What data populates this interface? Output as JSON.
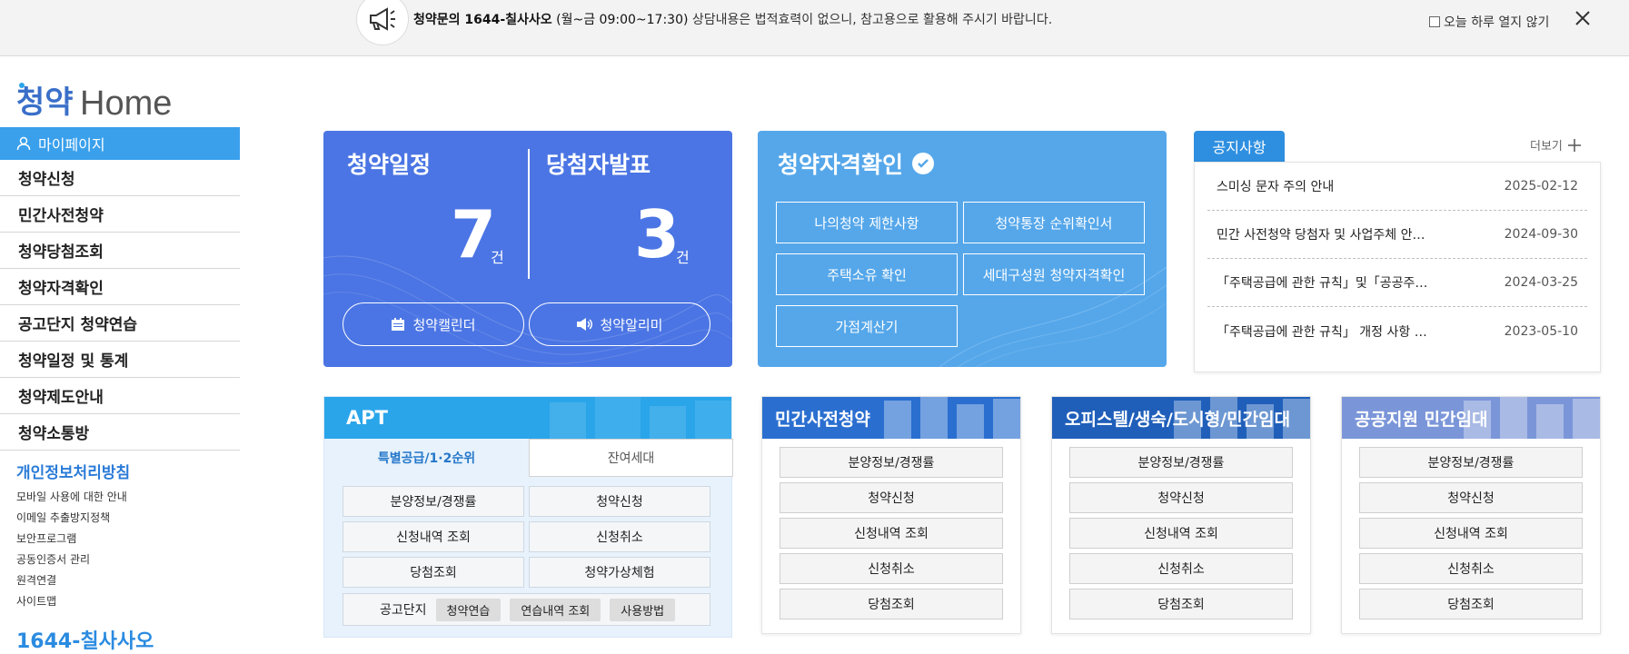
{
  "topbar": {
    "notice_bold": "청약문의 1644-칠사사오",
    "notice_hours": "(월~금 09:00~17:30)",
    "notice_rest": "상담내용은 법적효력이 없으니, 참고용으로 활용해 주시기 바랍니다.",
    "today_close_label": "오늘 하루 열지 않기"
  },
  "colors": {
    "sidebar_active": "#3aa0ec",
    "schedule_card": "#4b75e4",
    "qual_card": "#55a7ea",
    "notice_tab": "#2e8fe0",
    "apt_head": "#2aa5ea",
    "private_head": "#2a6fd0",
    "officetel_head": "#1f5fba",
    "public_head": "#7b96d8"
  },
  "sidebar": {
    "mypage": "마이페이지",
    "items": [
      {
        "label": "청약신청"
      },
      {
        "label": "민간사전청약"
      },
      {
        "label": "청약당첨조회"
      },
      {
        "label": "청약자격확인"
      },
      {
        "label": "공고단지 청약연습"
      },
      {
        "label": "청약일정 및 통계"
      },
      {
        "label": "청약제도안내"
      },
      {
        "label": "청약소통방"
      }
    ],
    "privacy": "개인정보처리방침",
    "links": [
      "모바일 사용에 대한 안내",
      "이메일 추출방지정책",
      "보안프로그램",
      "공동인증서 관리",
      "원격연결",
      "사이트맵"
    ],
    "phone": "1644-칠사사오"
  },
  "schedule": {
    "title_left": "청약일정",
    "title_right": "당첨자발표",
    "count_left": "7",
    "count_right": "3",
    "unit": "건",
    "btn_calendar": "청약캘린더",
    "btn_alarm": "청약알리미"
  },
  "qualification": {
    "title": "청약자격확인",
    "buttons": [
      "나의청약 제한사항",
      "청약통장 순위확인서",
      "주택소유 확인",
      "세대구성원 청약자격확인",
      "가점계산기"
    ]
  },
  "notices": {
    "tab": "공지사항",
    "more": "더보기",
    "items": [
      {
        "title": "스미싱 문자 주의 안내",
        "date": "2025-02-12"
      },
      {
        "title": "민간 사전청약 당첨자 및 사업주체 안…",
        "date": "2024-09-30"
      },
      {
        "title": "「주택공급에 관한 규칙」및「공공주…",
        "date": "2024-03-25"
      },
      {
        "title": "「주택공급에 관한 규칙」 개정 사항 …",
        "date": "2023-05-10"
      }
    ]
  },
  "apt": {
    "title": "APT",
    "tab_special": "특별공급/1·2순위",
    "tab_remaining": "잔여세대",
    "buttons": [
      "분양정보/경쟁률",
      "청약신청",
      "신청내역 조회",
      "신청취소",
      "당첨조회",
      "청약가상체험"
    ],
    "practice_label": "공고단지",
    "practice_chips": [
      "청약연습",
      "연습내역 조회",
      "사용방법"
    ]
  },
  "panels": [
    {
      "title": "민간사전청약",
      "buttons": [
        "분양정보/경쟁률",
        "청약신청",
        "신청내역 조회",
        "신청취소",
        "당첨조회"
      ]
    },
    {
      "title": "오피스텔/생숙/도시형/민간임대",
      "buttons": [
        "분양정보/경쟁률",
        "청약신청",
        "신청내역 조회",
        "신청취소",
        "당첨조회"
      ]
    },
    {
      "title": "공공지원 민간임대",
      "buttons": [
        "분양정보/경쟁률",
        "청약신청",
        "신청내역 조회",
        "신청취소",
        "당첨조회"
      ]
    }
  ]
}
